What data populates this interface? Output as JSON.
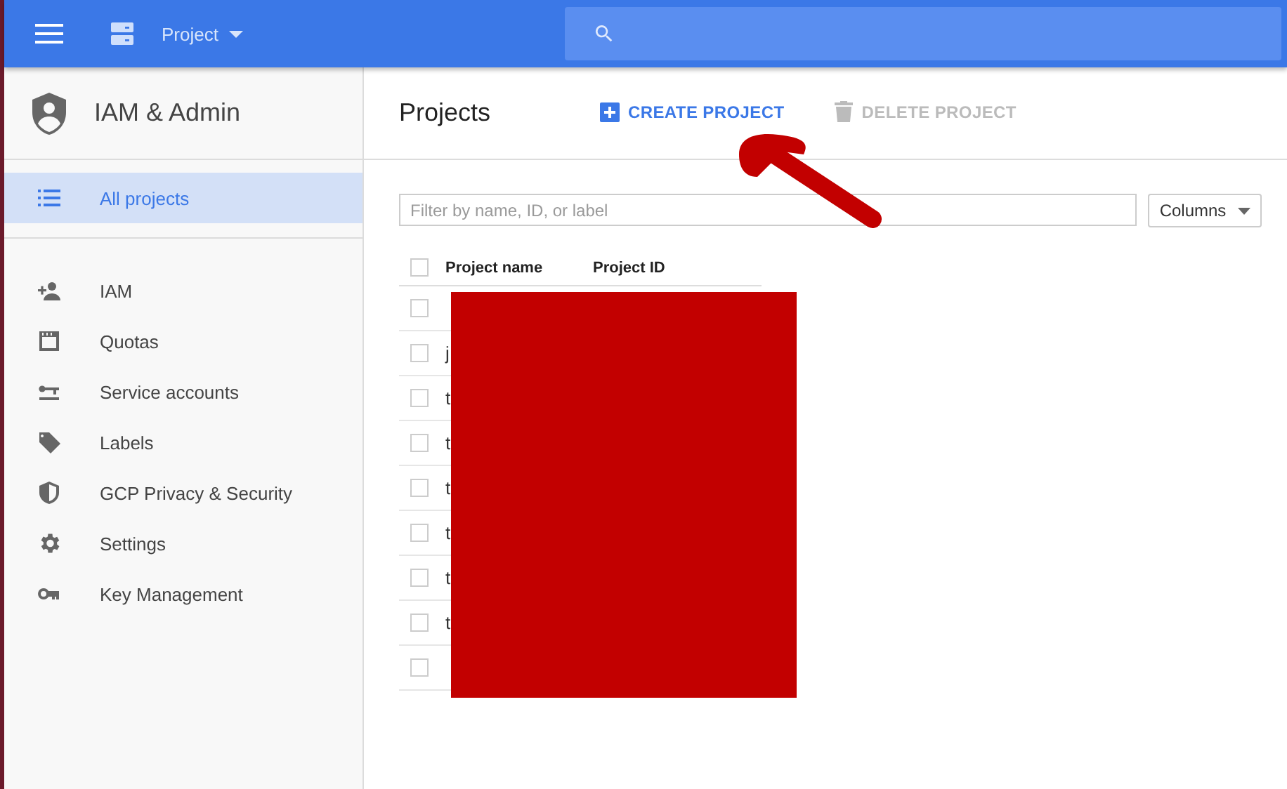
{
  "top_bar": {
    "project_selector": "Project"
  },
  "sidebar": {
    "title": "IAM & Admin",
    "items": [
      {
        "label": "All projects",
        "selected": true
      },
      {
        "label": "IAM",
        "selected": false
      },
      {
        "label": "Quotas",
        "selected": false
      },
      {
        "label": "Service accounts",
        "selected": false
      },
      {
        "label": "Labels",
        "selected": false
      },
      {
        "label": "GCP Privacy & Security",
        "selected": false
      },
      {
        "label": "Settings",
        "selected": false
      },
      {
        "label": "Key Management",
        "selected": false
      }
    ]
  },
  "main": {
    "title": "Projects",
    "actions": [
      {
        "label": "CREATE PROJECT",
        "disabled": false
      },
      {
        "label": "DELETE PROJECT",
        "disabled": true
      }
    ],
    "filter": {
      "placeholder": "Filter by name, ID, or label"
    },
    "columns_button": "Columns",
    "table": {
      "all_checked": false,
      "columns": [
        "Project name",
        "Project ID"
      ],
      "rows": [
        {
          "checked": false
        },
        {
          "name": "j",
          "checked": false
        },
        {
          "name": "t",
          "checked": false
        },
        {
          "name": "t",
          "checked": false
        },
        {
          "name": "t",
          "checked": false
        },
        {
          "name": "t",
          "checked": false
        },
        {
          "name": "t",
          "checked": false
        },
        {
          "name": "t",
          "checked": false
        },
        {
          "checked": false
        }
      ]
    }
  }
}
